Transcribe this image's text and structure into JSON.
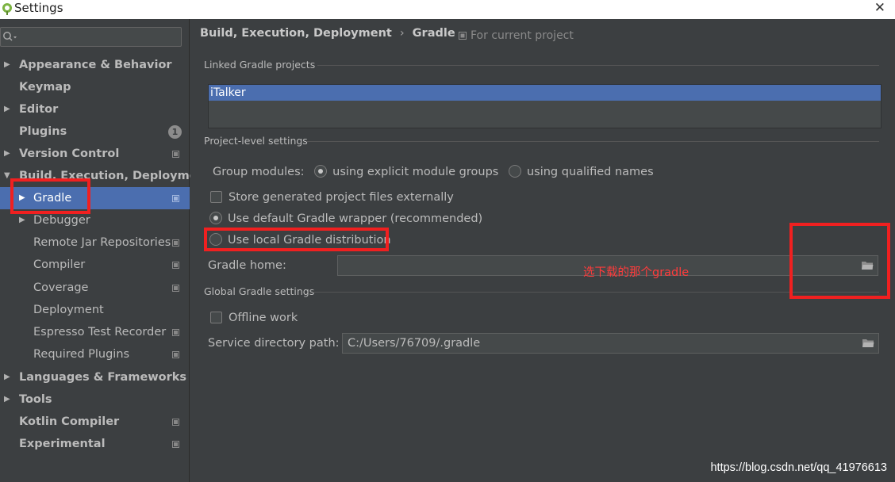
{
  "window": {
    "title": "Settings",
    "close_glyph": "✕"
  },
  "sidebar": {
    "search_placeholder": "",
    "items": [
      {
        "label": "Appearance & Behavior",
        "expand": "▶",
        "bold": true
      },
      {
        "label": "Keymap",
        "bold": true
      },
      {
        "label": "Editor",
        "expand": "▶",
        "bold": true
      },
      {
        "label": "Plugins",
        "bold": true,
        "badge": "1"
      },
      {
        "label": "Version Control",
        "expand": "▶",
        "bold": true
      },
      {
        "label": "Build, Execution, Deployment",
        "expand": "▼",
        "bold": true
      },
      {
        "label": "Gradle",
        "expand": "▶",
        "selected": true
      },
      {
        "label": "Debugger",
        "expand": "▶"
      },
      {
        "label": "Remote Jar Repositories"
      },
      {
        "label": "Compiler"
      },
      {
        "label": "Coverage"
      },
      {
        "label": "Deployment"
      },
      {
        "label": "Espresso Test Recorder"
      },
      {
        "label": "Required Plugins"
      },
      {
        "label": "Languages & Frameworks",
        "expand": "▶",
        "bold": true
      },
      {
        "label": "Tools",
        "expand": "▶",
        "bold": true
      },
      {
        "label": "Kotlin Compiler",
        "bold": true
      },
      {
        "label": "Experimental",
        "bold": true
      }
    ]
  },
  "breadcrumb": {
    "parent": "Build, Execution, Deployment",
    "separator": "›",
    "current": "Gradle"
  },
  "for_current_project": "For current project",
  "linked": {
    "title": "Linked Gradle projects",
    "projects": [
      "iTalker"
    ]
  },
  "project_level": {
    "title": "Project-level settings",
    "group_modules_label": "Group modules:",
    "group_option_1": "using explicit module groups",
    "group_option_2": "using qualified names",
    "group_selected": "using explicit module groups",
    "store_externally": "Store generated project files externally",
    "use_wrapper": "Use default Gradle wrapper (recommended)",
    "use_local": "Use local Gradle distribution",
    "gradle_home_label": "Gradle home:",
    "gradle_home_value": ""
  },
  "annotation": {
    "text": "选下载的那个gradle",
    "color": "#ff3b3b"
  },
  "global": {
    "title": "Global Gradle settings",
    "offline_work": "Offline work",
    "service_dir_label": "Service directory path:",
    "service_dir_value": "C:/Users/76709/.gradle"
  },
  "watermark": "https://blog.csdn.net/qq_41976613",
  "colors": {
    "selection": "#4b6eaf",
    "background": "#3c3f41",
    "annotation_box": "#f02020"
  }
}
